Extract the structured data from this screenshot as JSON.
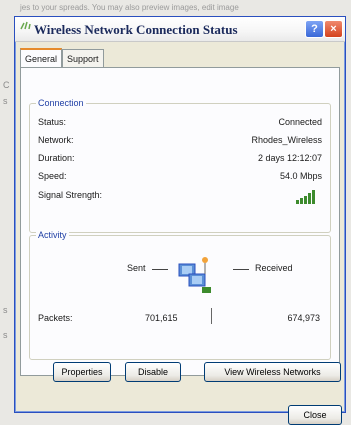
{
  "background": {
    "top_text": "jes to your spreads. You may also preview images, edit image",
    "left_fragments": [
      "C",
      "s",
      "s",
      "s"
    ]
  },
  "dialog": {
    "title": "Wireless Network Connection Status",
    "title_icon": "wireless-network-icon",
    "controls": {
      "help": "?",
      "close": "×"
    },
    "tabs": [
      {
        "label": "General",
        "active": true
      },
      {
        "label": "Support",
        "active": false
      }
    ],
    "connection": {
      "group_title": "Connection",
      "rows": [
        {
          "label": "Status:",
          "value": "Connected"
        },
        {
          "label": "Network:",
          "value": "Rhodes_Wireless"
        },
        {
          "label": "Duration:",
          "value": "2 days 12:12:07"
        },
        {
          "label": "Speed:",
          "value": "54.0 Mbps"
        }
      ],
      "signal_label": "Signal Strength:",
      "signal_icon": "signal-strength-bars-icon",
      "signal_bars": 5
    },
    "activity": {
      "group_title": "Activity",
      "sent_label": "Sent",
      "received_label": "Received",
      "packets_label": "Packets:",
      "packets_sent": "701,615",
      "packets_received": "674,973",
      "icon": "network-computers-icon"
    },
    "buttons": {
      "properties": "Properties",
      "disable": "Disable",
      "view_wireless": "View Wireless Networks",
      "close": "Close"
    },
    "colors": {
      "accent": "#2a4fbf",
      "group_title": "#1f3fa5",
      "tab_highlight": "#e68b2c",
      "signal": "#3d8b2d"
    }
  }
}
